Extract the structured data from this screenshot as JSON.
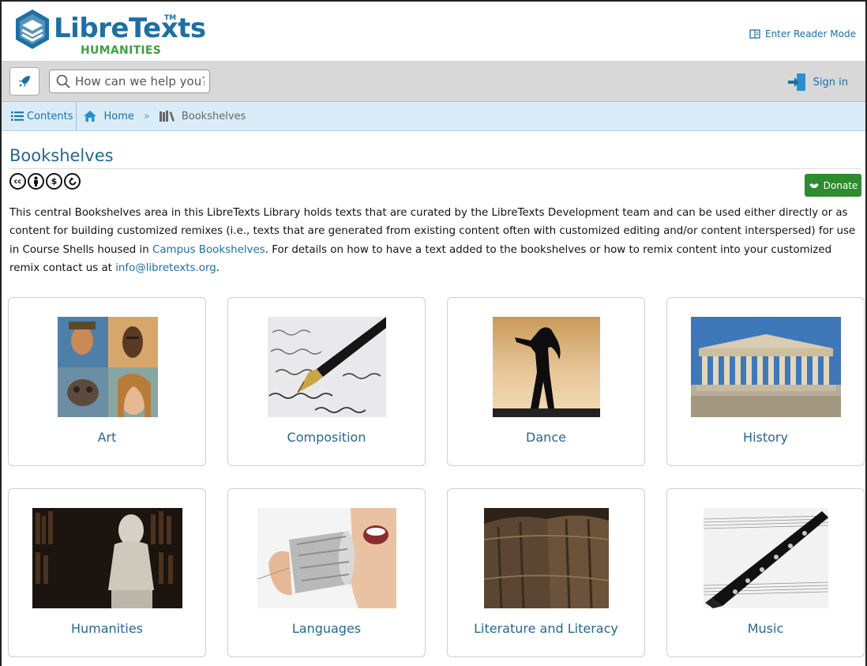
{
  "header": {
    "logo_word": "LibreTexts",
    "logo_tm": "TM",
    "logo_sub": "HUMANITIES",
    "reader_mode_label": "Enter Reader Mode"
  },
  "toolbar": {
    "search_placeholder": "How can we help you?",
    "signin_label": "Sign in"
  },
  "breadcrumb": {
    "contents_label": "Contents",
    "home_label": "Home",
    "separator": "»",
    "current_label": "Bookshelves"
  },
  "page": {
    "title": "Bookshelves",
    "license_icons": [
      "cc-icon",
      "by-icon",
      "nc-icon",
      "sa-icon"
    ],
    "donate_label": "Donate",
    "description": {
      "part1": "This central Bookshelves area in this LibreTexts Library holds texts that are curated by the LibreTexts Development team and can be used either directly or as content for building customized remixes (i.e., texts that are generated from existing content often with customized editing and/or content interspersed) for use in Course Shells housed in ",
      "link1": "Campus Bookshelves",
      "part2": ". For details on how to have a text added to the bookshelves or how to remix content into your customized remix contact us at ",
      "link2": "info@libretexts.org",
      "part3": "."
    }
  },
  "shelves": [
    {
      "label": "Art",
      "image": "art-collage-image"
    },
    {
      "label": "Composition",
      "image": "fountain-pen-image"
    },
    {
      "label": "Dance",
      "image": "dancer-silhouette-image"
    },
    {
      "label": "History",
      "image": "parthenon-image"
    },
    {
      "label": "Humanities",
      "image": "library-bust-image"
    },
    {
      "label": "Languages",
      "image": "tin-can-phone-image"
    },
    {
      "label": "Literature and Literacy",
      "image": "old-books-image"
    },
    {
      "label": "Music",
      "image": "clarinet-sheet-music-image"
    }
  ],
  "colors": {
    "brand_blue": "#1d6fa5",
    "brand_green": "#3fa142",
    "donate_green": "#2e8b2e",
    "breadcrumb_bg": "#d9ecf7",
    "toolbar_bg": "#d8d8d8"
  }
}
